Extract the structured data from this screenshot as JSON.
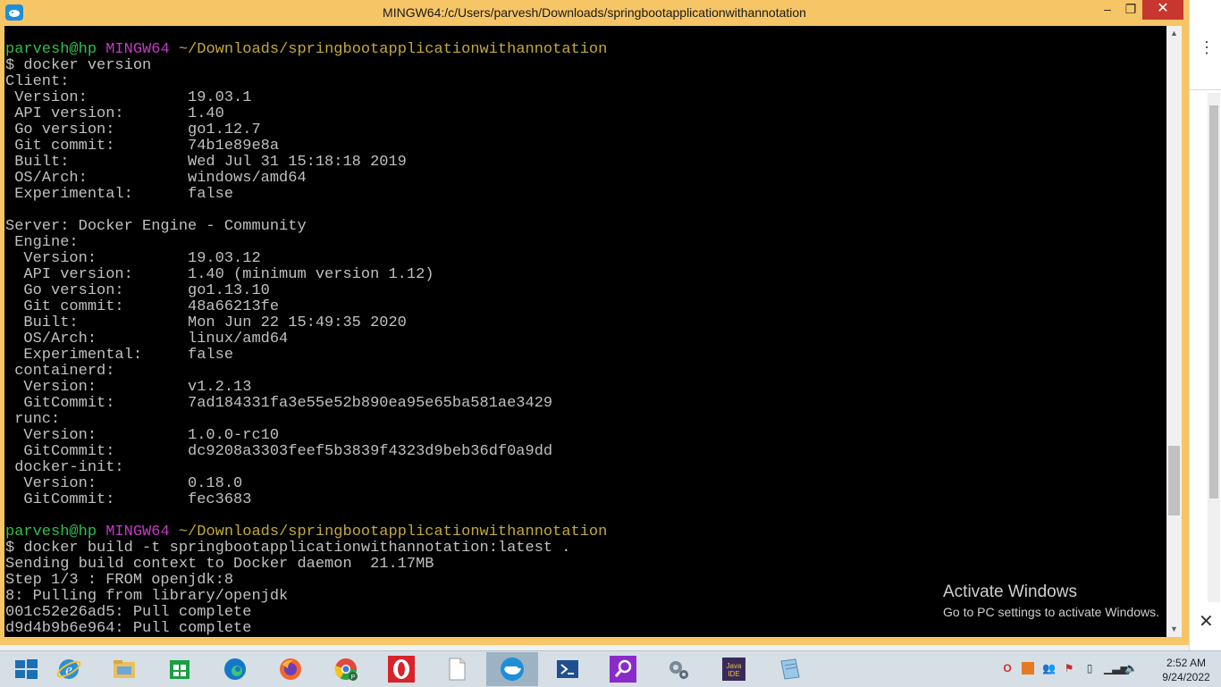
{
  "window": {
    "title": "MINGW64:/c/Users/parvesh/Downloads/springbootapplicationwithannotation",
    "minimize_glyph": "–",
    "maximize_glyph": "❐",
    "close_glyph": "✕"
  },
  "terminal": {
    "lines": [
      {
        "user": "parvesh@hp",
        "host": "MINGW64",
        "path": "~/Downloads/springbootapplicationwithannotation"
      },
      "$ docker version",
      "Client:",
      " Version:           19.03.1",
      " API version:       1.40",
      " Go version:        go1.12.7",
      " Git commit:        74b1e89e8a",
      " Built:             Wed Jul 31 15:18:18 2019",
      " OS/Arch:           windows/amd64",
      " Experimental:      false",
      "",
      "Server: Docker Engine - Community",
      " Engine:",
      "  Version:          19.03.12",
      "  API version:      1.40 (minimum version 1.12)",
      "  Go version:       go1.13.10",
      "  Git commit:       48a66213fe",
      "  Built:            Mon Jun 22 15:49:35 2020",
      "  OS/Arch:          linux/amd64",
      "  Experimental:     false",
      " containerd:",
      "  Version:          v1.2.13",
      "  GitCommit:        7ad184331fa3e55e52b890ea95e65ba581ae3429",
      " runc:",
      "  Version:          1.0.0-rc10",
      "  GitCommit:        dc9208a3303feef5b3839f4323d9beb36df0a9dd",
      " docker-init:",
      "  Version:          0.18.0",
      "  GitCommit:        fec3683",
      "",
      {
        "user": "parvesh@hp",
        "host": "MINGW64",
        "path": "~/Downloads/springbootapplicationwithannotation"
      },
      "$ docker build -t springbootapplicationwithannotation:latest .",
      "Sending build context to Docker daemon  21.17MB",
      "Step 1/3 : FROM openjdk:8",
      "8: Pulling from library/openjdk",
      "001c52e26ad5: Pull complete",
      "d9d4b9b6e964: Pull complete"
    ]
  },
  "watermark": {
    "title": "Activate Windows",
    "subtitle": "Go to PC settings to activate Windows."
  },
  "taskbar": {
    "items": [
      {
        "name": "start-button",
        "icon": "windows-logo-icon",
        "active": false
      },
      {
        "name": "taskbar-internet-explorer",
        "icon": "internet-explorer-icon",
        "active": false
      },
      {
        "name": "taskbar-file-explorer",
        "icon": "file-explorer-icon",
        "active": false
      },
      {
        "name": "taskbar-store",
        "icon": "store-icon",
        "active": false
      },
      {
        "name": "taskbar-edge",
        "icon": "edge-icon",
        "active": false
      },
      {
        "name": "taskbar-firefox",
        "icon": "firefox-icon",
        "active": false
      },
      {
        "name": "taskbar-chrome",
        "icon": "chrome-icon",
        "active": false
      },
      {
        "name": "taskbar-opera",
        "icon": "opera-icon",
        "active": false
      },
      {
        "name": "taskbar-document",
        "icon": "document-icon",
        "active": false
      },
      {
        "name": "taskbar-docker",
        "icon": "docker-icon",
        "active": true
      },
      {
        "name": "taskbar-powershell",
        "icon": "powershell-icon",
        "active": false
      },
      {
        "name": "taskbar-search",
        "icon": "search-icon",
        "active": false
      },
      {
        "name": "taskbar-settings",
        "icon": "gear-icon",
        "active": false
      },
      {
        "name": "taskbar-javaee-ide",
        "icon": "javaee-ide-icon",
        "active": false
      },
      {
        "name": "taskbar-notepad",
        "icon": "notepad-icon",
        "active": false
      }
    ],
    "clock": {
      "time": "2:52 AM",
      "date": "9/24/2022"
    }
  }
}
